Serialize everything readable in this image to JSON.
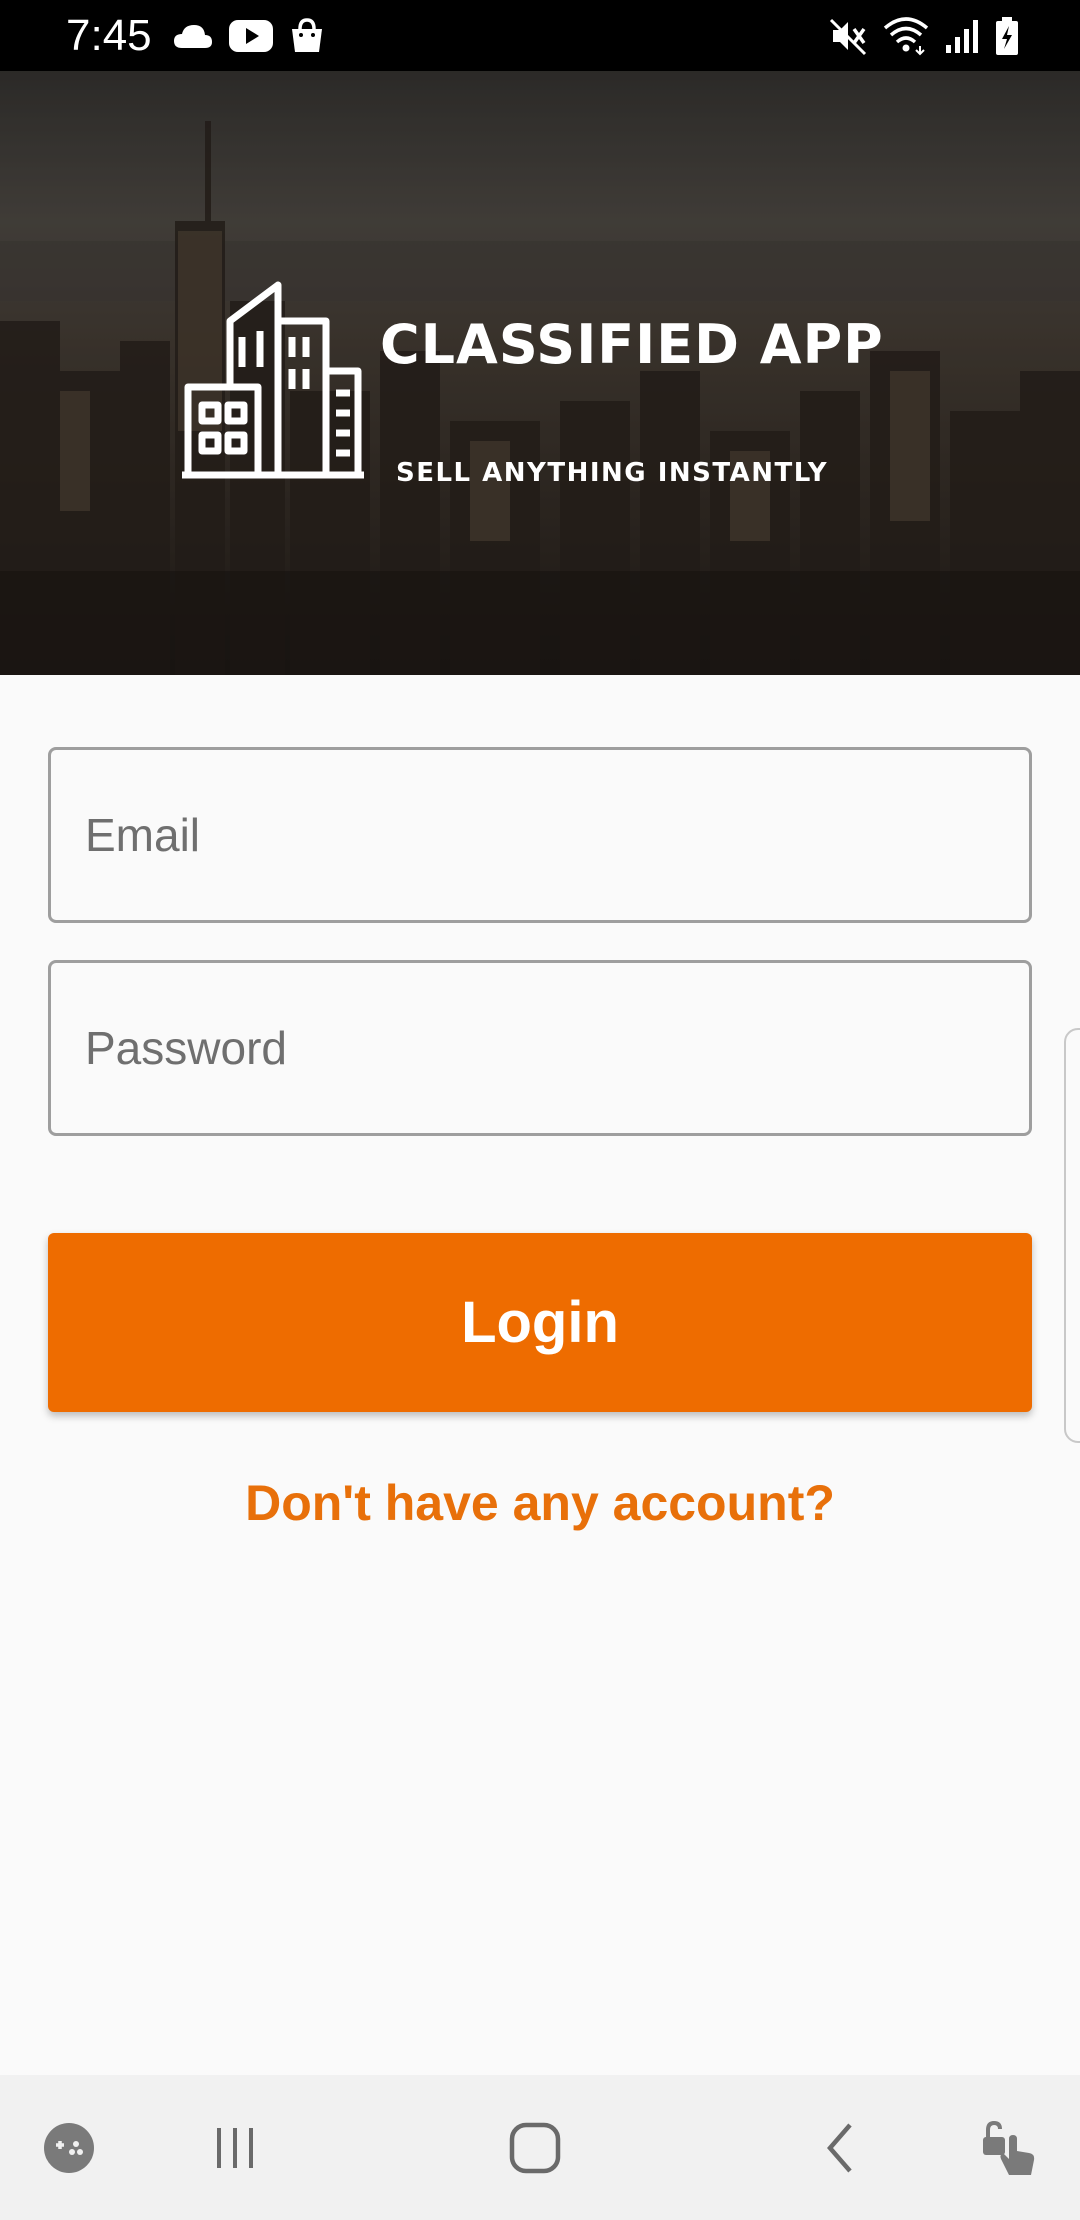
{
  "status_bar": {
    "time": "7:45",
    "left_icons": [
      "cloud-icon",
      "youtube-icon",
      "shopping-bag-icon"
    ],
    "right_icons": [
      "mute-icon",
      "wifi-icon",
      "signal-icon",
      "battery-charging-icon"
    ]
  },
  "hero": {
    "title": "CLASSIFIED APP",
    "subtitle": "SELL ANYTHING INSTANTLY",
    "logo_icon": "buildings-icon"
  },
  "form": {
    "email_placeholder": "Email",
    "email_value": "",
    "password_placeholder": "Password",
    "password_value": "",
    "login_label": "Login",
    "signup_link": "Don't have any account?"
  },
  "nav_bar": {
    "buttons": [
      "game-launcher-icon",
      "recent-apps-icon",
      "home-icon",
      "back-icon",
      "unlock-gesture-icon"
    ]
  },
  "colors": {
    "accent": "#EE6C00",
    "link": "#E8700A",
    "field_border": "#9E9E9E",
    "background": "#FAFAFA"
  }
}
